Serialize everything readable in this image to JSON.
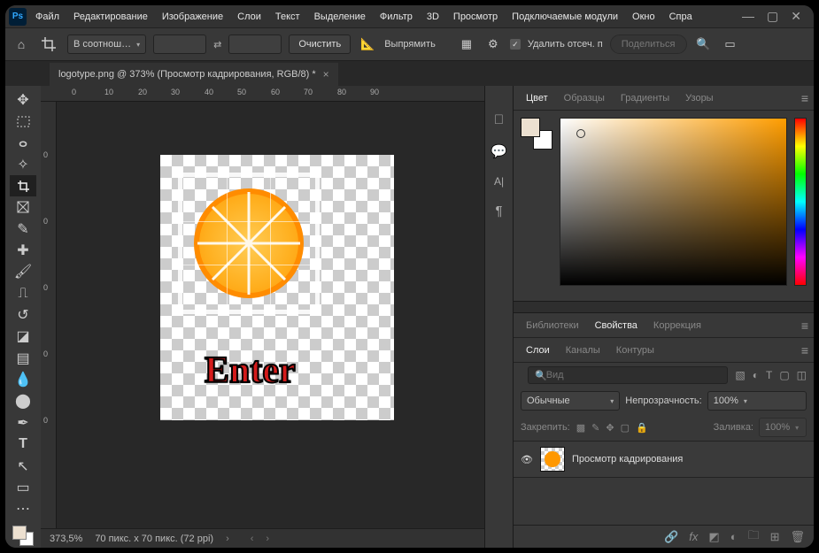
{
  "menu": [
    "Файл",
    "Редактирование",
    "Изображение",
    "Слои",
    "Текст",
    "Выделение",
    "Фильтр",
    "3D",
    "Просмотр",
    "Подключаемые модули",
    "Окно",
    "Спра"
  ],
  "options": {
    "ratio_label": "В соотнош…",
    "field1": "",
    "field2": "",
    "clear": "Очистить",
    "straighten": "Выпрямить",
    "delete_crop": "Удалить отсеч. п",
    "share": "Поделиться"
  },
  "tab": {
    "title": "logotype.png @ 373% (Просмотр кадрирования, RGB/8) *"
  },
  "ruler_h": [
    "0",
    "10",
    "20",
    "30",
    "40",
    "50",
    "60",
    "70",
    "80",
    "90"
  ],
  "ruler_v": [
    "0",
    "0",
    "0",
    "0",
    "0",
    "0"
  ],
  "canvas": {
    "enter": "Enter"
  },
  "status": {
    "zoom": "373,5%",
    "dim": "70 пикс. x 70 пикс. (72 ppi)"
  },
  "panels": {
    "color_tabs": [
      "Цвет",
      "Образцы",
      "Градиенты",
      "Узоры"
    ],
    "mid_tabs": [
      "Библиотеки",
      "Свойства",
      "Коррекция"
    ],
    "layer_tabs": [
      "Слои",
      "Каналы",
      "Контуры"
    ],
    "search_ph": "Вид",
    "blend": "Обычные",
    "opacity_label": "Непрозрачность:",
    "opacity": "100%",
    "lock_label": "Закрепить:",
    "fill_label": "Заливка:",
    "fill": "100%",
    "layer_name": "Просмотр кадрирования"
  }
}
